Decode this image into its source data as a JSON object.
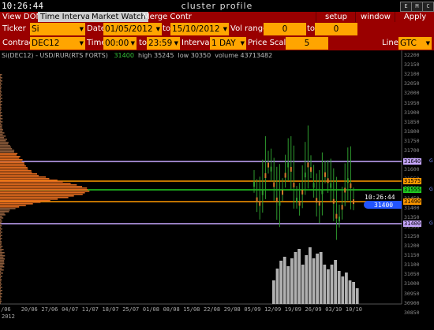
{
  "window": {
    "clock": "10:26:44",
    "title": "cluster profile",
    "buttons": [
      "E",
      "M",
      "C"
    ]
  },
  "menu": {
    "tabs": [
      {
        "label": "View DOM",
        "active": false
      },
      {
        "label": "Time Interval",
        "active": true
      },
      {
        "label": "Market Watch",
        "active": true
      },
      {
        "label": "Merge Contr",
        "active": false
      }
    ],
    "setup": "setup",
    "window": "window",
    "apply": "Apply"
  },
  "filters": {
    "ticker_label": "Ticker",
    "ticker": "Si",
    "date_label": "Date",
    "date_from": "01/05/2012",
    "to_label": "to",
    "date_to": "15/10/2012",
    "vol_range_label": "Vol range",
    "vol_from": "0",
    "vol_to_label": "to",
    "vol_to": "0",
    "contract_label": "Contract",
    "contract": "DEC12",
    "time_label": "Time",
    "time_from": "00:00",
    "time_to_label": "to",
    "time_to": "23:59",
    "interval_label": "Interval",
    "interval": "1 DAY",
    "price_scale_label": "Price Scale",
    "price_scale": "5",
    "line_label": "Line",
    "line": "GTC"
  },
  "chart_info": {
    "symbol": "Si(DEC12) - USD/RUR(RTS FORTS)",
    "last": "31400",
    "high": "high 35245",
    "low": "low 30350",
    "volume": "volume 43713482"
  },
  "price_axis": [
    "32200",
    "32150",
    "32100",
    "32050",
    "32000",
    "31950",
    "31900",
    "31850",
    "31800",
    "31750",
    "31700",
    "31650",
    "31600",
    "31550",
    "31500",
    "31450",
    "31400",
    "31350",
    "31300",
    "31250",
    "31200",
    "31150",
    "31100",
    "31050",
    "31000",
    "30950",
    "30900",
    "30850"
  ],
  "date_axis": [
    "/06",
    "20/06",
    "27/06",
    "04/07",
    "11/07",
    "18/07",
    "25/07",
    "01/08",
    "08/08",
    "15/08",
    "22/08",
    "29/08",
    "05/09",
    "12/09",
    "19/09",
    "26/09",
    "03/10",
    "10/10"
  ],
  "year_label": "2012",
  "current": {
    "time": "10:26:44",
    "price": "31400"
  },
  "levels": [
    {
      "label": "31640",
      "color": "#c8a8ff",
      "tag": "G"
    },
    {
      "label": "31575",
      "color": "#ff9900",
      "tag": ""
    },
    {
      "label": "31555",
      "color": "#22cc22",
      "tag": "G"
    },
    {
      "label": "31490",
      "color": "#ff9900",
      "tag": ""
    },
    {
      "label": "31400",
      "color": "#c8a8ff",
      "tag": "G"
    }
  ],
  "colors": {
    "menu_bg": "#9a0000",
    "field_bg": "#ffa500",
    "profile": "#e06a1e",
    "candle": "#2e9a2e",
    "volume": "#b0b0b0",
    "current_tag": "#2255ff"
  }
}
